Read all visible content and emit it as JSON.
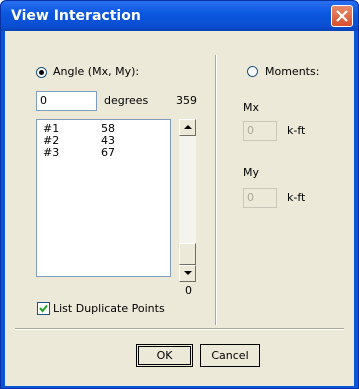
{
  "window": {
    "title": "View Interaction"
  },
  "angle": {
    "radio_label": "Angle (Mx, My):",
    "selected": true,
    "degrees_value": "0",
    "degrees_label": "degrees",
    "max_label": "359",
    "min_label": "0",
    "rows": [
      {
        "id": "#1",
        "value": "58"
      },
      {
        "id": "#2",
        "value": "43"
      },
      {
        "id": "#3",
        "value": "67"
      }
    ]
  },
  "moments": {
    "radio_label": "Moments:",
    "selected": false,
    "mx_label": "Mx",
    "mx_value": "0",
    "mx_unit": "k-ft",
    "my_label": "My",
    "my_value": "0",
    "my_unit": "k-ft"
  },
  "list_duplicate": {
    "label": "List Duplicate Points",
    "checked": true
  },
  "buttons": {
    "ok": "OK",
    "cancel": "Cancel"
  }
}
